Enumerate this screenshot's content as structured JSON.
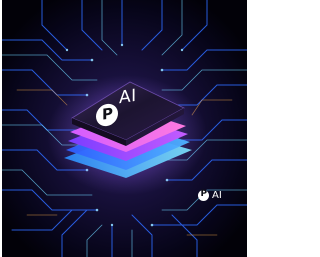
{
  "chip": {
    "logo_letter": "P",
    "label": "AI"
  },
  "watermark": {
    "logo_letter": "P",
    "label": "AI",
    "sub_lines": [
      "",
      ""
    ]
  },
  "colors": {
    "background": "#05030d",
    "trace_blue": "#2e6bff",
    "trace_cyan": "#6fd6ff",
    "glow_purple": "#b44dff",
    "glow_pink": "#ff5fd2"
  },
  "icons": [
    "p-logo-icon",
    "circuit-board-traces",
    "chip-stack"
  ]
}
